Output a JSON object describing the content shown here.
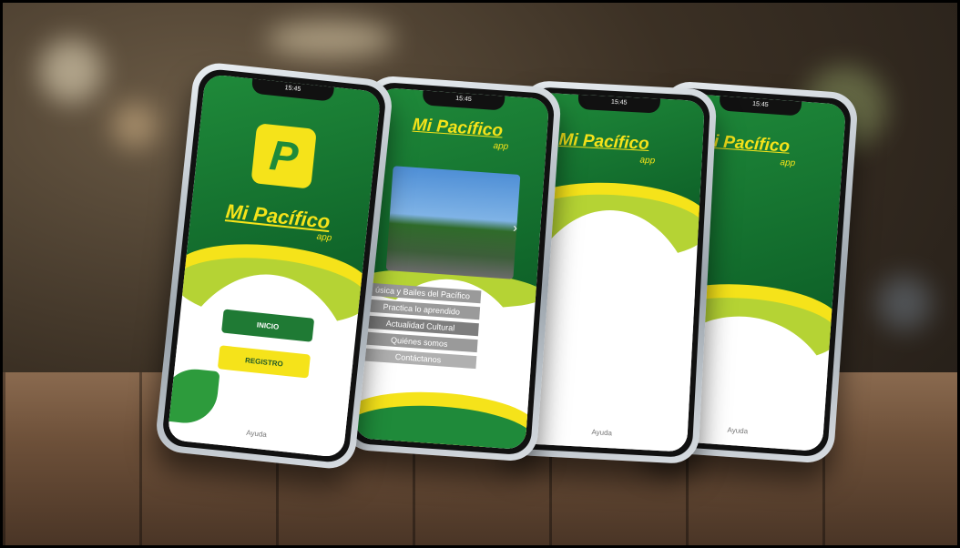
{
  "scene": {
    "background": "#2e251c",
    "table_color": "#6d5039"
  },
  "phones": [
    {
      "status_time": "15:45",
      "logo_text": "Mi Pacífico",
      "logo_sub": "app",
      "icon_letter": "P",
      "buttons": {
        "inicio": "INICIO",
        "registro": "REGISTRO"
      },
      "help": "Ayuda"
    },
    {
      "status_time": "15:45",
      "logo_text": "Mi Pacífico",
      "logo_sub": "app",
      "menu": [
        "úsica y Bailes del Pacífico",
        "Practica lo aprendido",
        "Actualidad Cultural",
        "Quiénes somos",
        "Contáctanos"
      ],
      "next_icon": "›"
    },
    {
      "status_time": "15:45",
      "logo_text": "Mi Pacífico",
      "logo_sub": "app",
      "help": "Ayuda"
    },
    {
      "status_time": "15:45",
      "logo_text": "Mi Pacífico",
      "logo_sub": "app",
      "help": "Ayuda"
    }
  ],
  "colors": {
    "green": "#1f8a3a",
    "yellow": "#f5e31a",
    "lime": "#b5d334",
    "menu_gray": "#9a9a9a"
  }
}
